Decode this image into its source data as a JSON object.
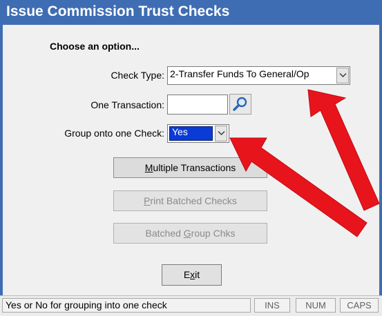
{
  "window": {
    "title": "Issue Commission Trust Checks"
  },
  "form": {
    "heading": "Choose an option...",
    "check_type": {
      "label": "Check Type:",
      "value": "2-Transfer Funds To General/Op"
    },
    "one_transaction": {
      "label": "One Transaction:",
      "value": ""
    },
    "group_onto_one_check": {
      "label": "Group onto one Check:",
      "value": "Yes"
    }
  },
  "buttons": {
    "multiple_transactions": {
      "mnemonic": "M",
      "rest": "ultiple Transactions"
    },
    "print_batched_checks": {
      "mnemonic": "P",
      "rest": "rint Batched Checks"
    },
    "batched_group_chks": {
      "before": "Batched ",
      "mnemonic": "G",
      "after": "roup Chks"
    },
    "exit": {
      "before": "E",
      "mnemonic": "x",
      "after": "it"
    }
  },
  "status": {
    "message": "Yes or No for grouping into one check",
    "indicators": [
      "INS",
      "NUM",
      "CAPS"
    ]
  },
  "colors": {
    "title_bar": "#3f6db3",
    "selection": "#0a3bd6",
    "annotation_arrow": "#e8141c"
  },
  "icons": {
    "dropdown": "chevron-down-icon",
    "lookup": "magnifier-icon"
  }
}
